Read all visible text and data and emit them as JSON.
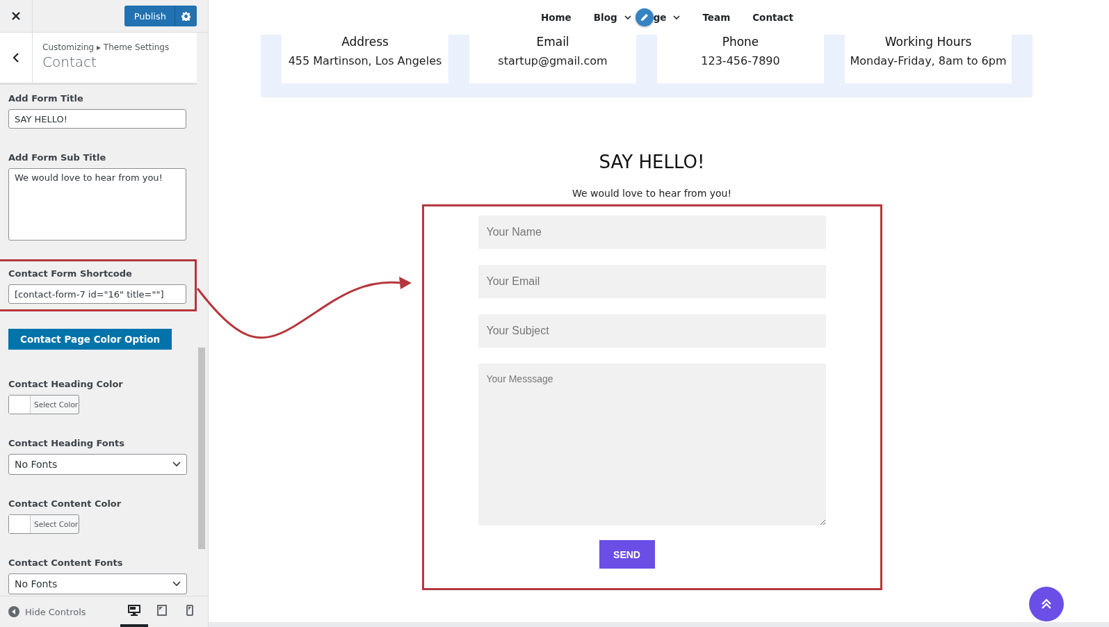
{
  "sidebar": {
    "publish": "Publish",
    "breadcrumb": "Customizing ▸ Theme Settings",
    "section_title": "Contact",
    "controls": [
      {
        "kind": "text",
        "label": "Add Form Title",
        "value": "SAY HELLO!",
        "highlighted": false
      },
      {
        "kind": "textarea",
        "label": "Add Form Sub Title",
        "value": "We would love to hear from you!",
        "highlighted": false
      },
      {
        "kind": "text",
        "label": "Contact Form Shortcode",
        "value": "[contact-form-7 id=\"16\" title=\"\"]",
        "highlighted": true
      },
      {
        "kind": "button",
        "label": "Contact Page Color Option"
      },
      {
        "kind": "color",
        "label": "Contact Heading Color",
        "button": "Select Color"
      },
      {
        "kind": "select",
        "label": "Contact Heading Fonts",
        "value": "No Fonts"
      },
      {
        "kind": "color",
        "label": "Contact Content Color",
        "button": "Select Color"
      },
      {
        "kind": "select",
        "label": "Contact Content Fonts",
        "value": "No Fonts"
      }
    ],
    "footer": {
      "hide_controls": "Hide Controls",
      "devices": [
        {
          "kind": "desktop",
          "selected": true
        },
        {
          "kind": "tablet",
          "selected": false
        },
        {
          "kind": "mobile",
          "selected": false
        }
      ]
    }
  },
  "preview": {
    "nav": [
      {
        "label": "Home",
        "dropdown": false
      },
      {
        "label": "Blog",
        "dropdown": true
      },
      {
        "label": "ge",
        "dropdown": true
      },
      {
        "label": "Team",
        "dropdown": false
      },
      {
        "label": "Contact",
        "dropdown": false
      }
    ],
    "info_cards": [
      {
        "heading": "Address",
        "text": "455 Martinson, Los Angeles"
      },
      {
        "heading": "Email",
        "text": "startup@gmail.com"
      },
      {
        "heading": "Phone",
        "text": "123-456-7890"
      },
      {
        "heading": "Working Hours",
        "text": "Monday-Friday, 8am to 6pm"
      }
    ],
    "form_title": "SAY HELLO!",
    "form_subtitle": "We would love to hear from you!",
    "fields": [
      {
        "kind": "input",
        "placeholder": "Your Name"
      },
      {
        "kind": "input",
        "placeholder": "Your Email"
      },
      {
        "kind": "input",
        "placeholder": "Your Subject"
      },
      {
        "kind": "textarea",
        "placeholder": "Your Messsage"
      }
    ],
    "send": "SEND"
  }
}
